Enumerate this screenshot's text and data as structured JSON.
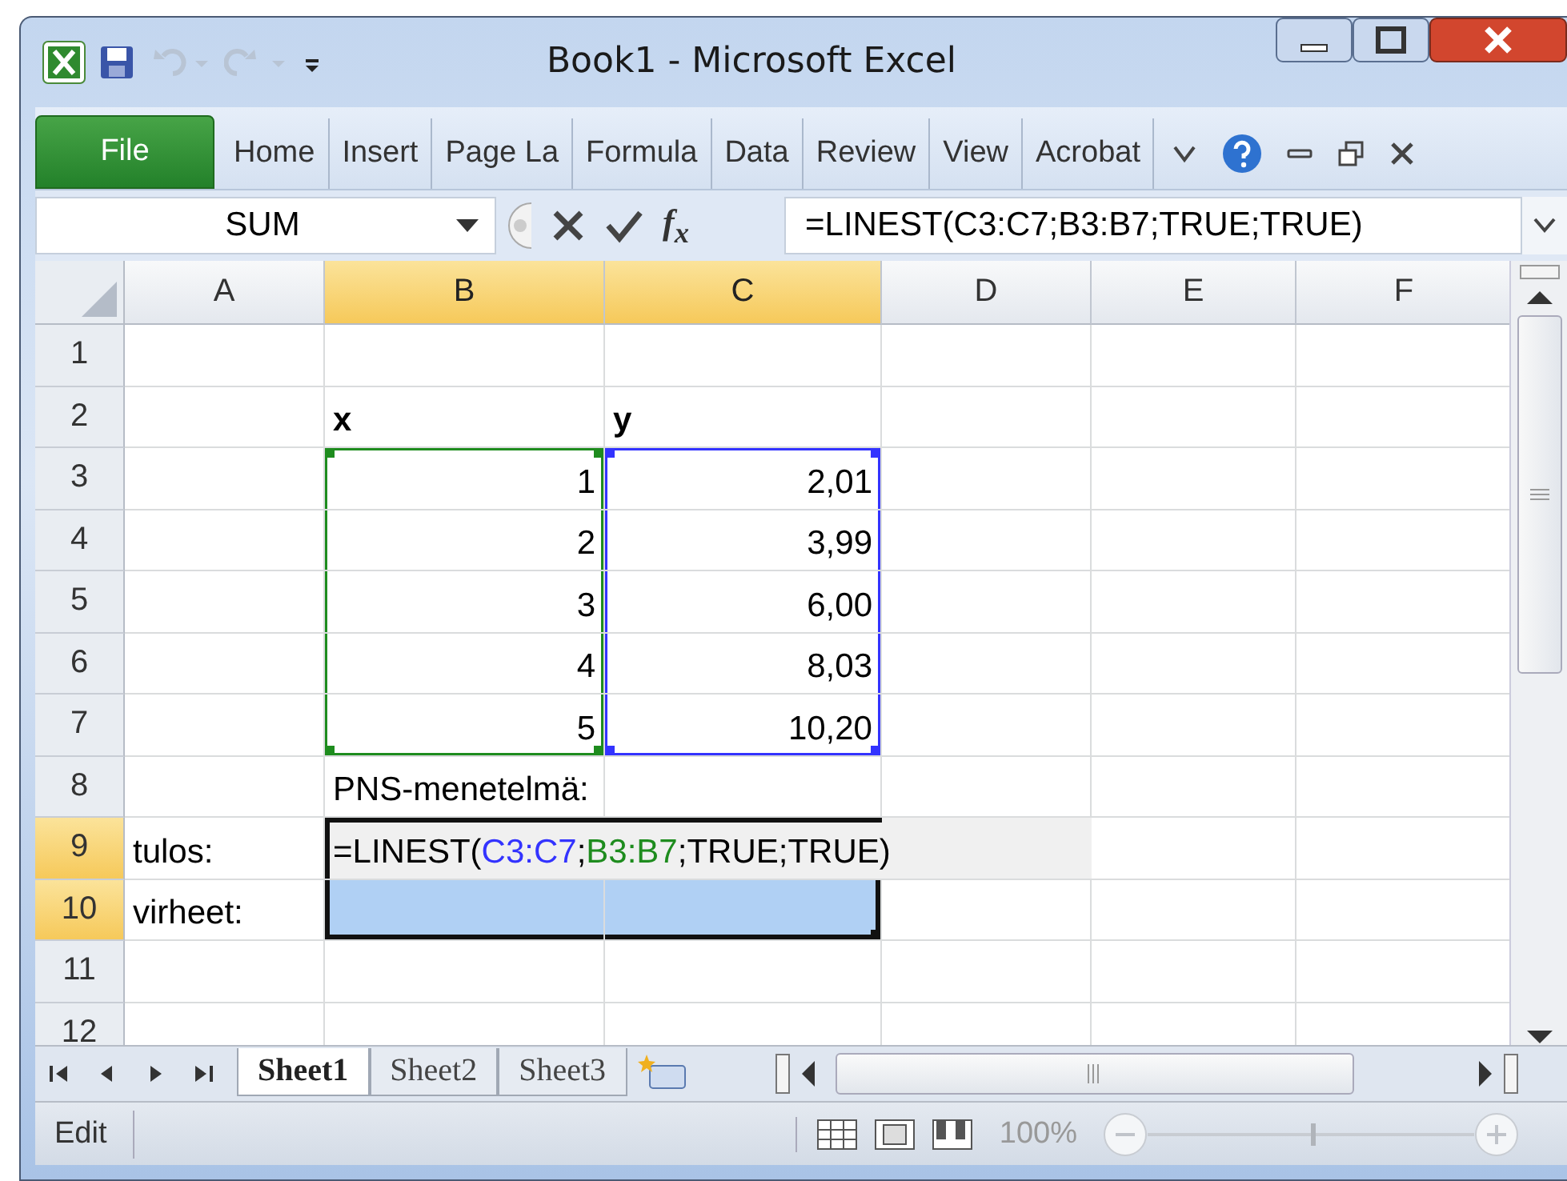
{
  "window": {
    "title": "Book1  -  Microsoft Excel"
  },
  "file_button": "File",
  "ribbon_tabs": [
    {
      "label": "Home",
      "selected": false
    },
    {
      "label": "Insert",
      "selected": false
    },
    {
      "label": "Page La",
      "selected": false
    },
    {
      "label": "Formula",
      "selected": false
    },
    {
      "label": "Data",
      "selected": false
    },
    {
      "label": "Review",
      "selected": false
    },
    {
      "label": "View",
      "selected": false
    },
    {
      "label": "Acrobat",
      "selected": false
    }
  ],
  "formula_bar": {
    "name_box": "SUM",
    "function_label": "f$_{x}$",
    "formula": "=LINEST(C3:C7;B3:B7;TRUE;TRUE)"
  },
  "columns": [
    {
      "label": "A",
      "selected": false
    },
    {
      "label": "B",
      "selected": true
    },
    {
      "label": "C",
      "selected": true
    },
    {
      "label": "D",
      "selected": false
    },
    {
      "label": "E",
      "selected": false
    },
    {
      "label": "F",
      "selected": false
    }
  ],
  "rows": [
    {
      "label": "1",
      "selected": false
    },
    {
      "label": "2",
      "selected": false,
      "cells": [
        null,
        {
          "text": "x",
          "kind": "heading"
        },
        {
          "text": "y",
          "kind": "heading"
        }
      ]
    },
    {
      "label": "3",
      "selected": false,
      "cells": [
        null,
        {
          "text": "1",
          "kind": "number",
          "color": "#1e8c1e"
        },
        {
          "text": "2,01",
          "kind": "number",
          "color": "#3333ff"
        }
      ]
    },
    {
      "label": "4",
      "selected": false,
      "cells": [
        null,
        {
          "text": "2",
          "kind": "number",
          "color": "#1e8c1e"
        },
        {
          "text": "3,99",
          "kind": "number",
          "color": "#3333ff"
        }
      ]
    },
    {
      "label": "5",
      "selected": false,
      "cells": [
        null,
        {
          "text": "3",
          "kind": "number",
          "color": "#1e8c1e"
        },
        {
          "text": "6,00",
          "kind": "number",
          "color": "#3333ff"
        }
      ]
    },
    {
      "label": "6",
      "selected": false,
      "cells": [
        null,
        {
          "text": "4",
          "kind": "number",
          "color": "#1e8c1e"
        },
        {
          "text": "8,03",
          "kind": "number",
          "color": "#3333ff"
        }
      ]
    },
    {
      "label": "7",
      "selected": false,
      "cells": [
        null,
        {
          "text": "5",
          "kind": "number",
          "color": "#1e8c1e"
        },
        {
          "text": "10,20",
          "kind": "number",
          "color": "#3333ff"
        }
      ]
    },
    {
      "label": "8",
      "selected": false,
      "cells": [
        null,
        {
          "text": "PNS-menetelmä:",
          "kind": "label"
        }
      ]
    },
    {
      "label": "9",
      "selected": true,
      "cells": [
        {
          "text": "tulos:",
          "kind": "label"
        },
        {
          "kind": "formula",
          "selected": true,
          "segments": [
            {
              "text": "=LINEST(",
              "color": "#000000"
            },
            {
              "text": "C3:C7",
              "color": "#3333ff"
            },
            {
              "text": ";",
              "color": "#000000"
            },
            {
              "text": "B3:B7",
              "color": "#1e8c1e"
            },
            {
              "text": ";TRUE;TRUE)",
              "color": "#000000"
            }
          ]
        }
      ]
    },
    {
      "label": "10",
      "selected": true,
      "cells": [
        {
          "text": "virheet:",
          "kind": "label"
        },
        {
          "kind": "blank",
          "selected": true
        },
        {
          "kind": "blank",
          "selected": true
        }
      ]
    },
    {
      "label": "11",
      "selected": false
    },
    {
      "label": "12",
      "selected": false
    }
  ],
  "sheet_tabs": [
    {
      "label": "Sheet1",
      "selected": true
    },
    {
      "label": "Sheet2",
      "selected": false
    },
    {
      "label": "Sheet3",
      "selected": false
    }
  ],
  "status_bar": {
    "mode": "Edit",
    "zoom": {
      "label": "100%",
      "level": 0.5
    }
  }
}
